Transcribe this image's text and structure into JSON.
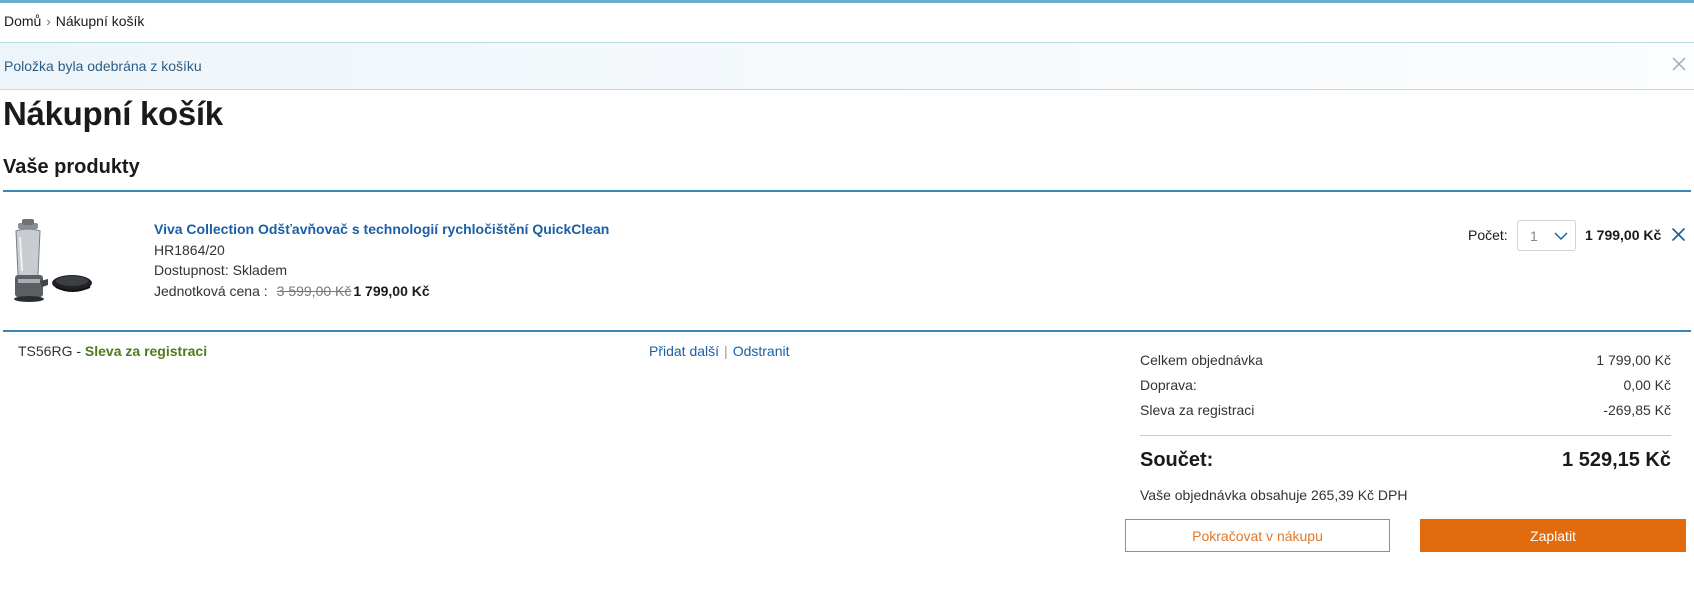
{
  "breadcrumb": {
    "home": "Domů",
    "separator": "›",
    "current": "Nákupní košík"
  },
  "notice": {
    "text": "Položka byla odebrána z košíku",
    "close_icon": "close-icon"
  },
  "page": {
    "title": "Nákupní košík",
    "section_title": "Vaše produkty"
  },
  "product": {
    "name": "Viva Collection Odšťavňovač s technologií rychločištění QuickClean",
    "sku": "HR1864/20",
    "availability": "Dostupnost: Skladem",
    "unit_price_label": "Jednotková cena :",
    "old_price": "3 599,00 Kč",
    "new_price": "1 799,00 Kč",
    "image_icon": "juicer-product-image",
    "quantity_label": "Počet:",
    "quantity_value": "1",
    "line_price": "1 799,00 Kč",
    "remove_icon": "close-icon"
  },
  "voucher": {
    "code": "TS56RG",
    "dash": " - ",
    "name": "Sleva za registraci",
    "add_label": "Přidat další",
    "divider": "|",
    "remove_label": "Odstranit"
  },
  "summary": {
    "rows": [
      {
        "label": "Celkem objednávka",
        "value": "1 799,00 Kč"
      },
      {
        "label": "Doprava:",
        "value": "0,00 Kč"
      },
      {
        "label": "Sleva za registraci",
        "value": "-269,85 Kč"
      }
    ],
    "total_label": "Součet:",
    "total_value": "1 529,15 Kč",
    "vat_note": "Vaše objednávka obsahuje 265,39 Kč DPH"
  },
  "buttons": {
    "continue_label": "Pokračovat v nákupu",
    "pay_label": "Zaplatit"
  },
  "colors": {
    "accent_blue": "#3a87b5",
    "link_blue": "#1b5ea5",
    "voucher_green": "#4f7a1e",
    "cta_orange": "#e06c0f"
  }
}
